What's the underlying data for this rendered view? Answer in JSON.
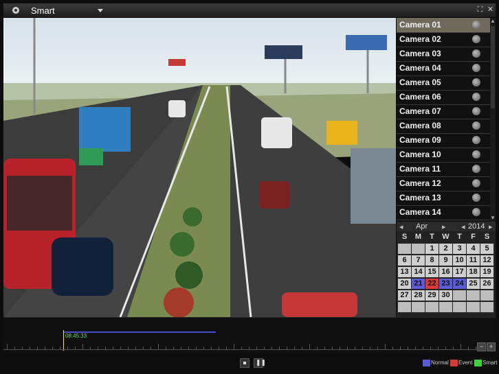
{
  "titlebar": {
    "title": "Smart"
  },
  "cameras": [
    "Camera 01",
    "Camera 02",
    "Camera 03",
    "Camera 04",
    "Camera 05",
    "Camera 06",
    "Camera 07",
    "Camera 08",
    "Camera 09",
    "Camera 10",
    "Camera 11",
    "Camera 12",
    "Camera 13",
    "Camera 14"
  ],
  "selected_camera_index": 0,
  "calendar": {
    "month": "Apr",
    "year": "2014",
    "weekdays": [
      "S",
      "M",
      "T",
      "W",
      "T",
      "F",
      "S"
    ],
    "weeks": [
      [
        "",
        "",
        "1",
        "2",
        "3",
        "4",
        "5"
      ],
      [
        "6",
        "7",
        "8",
        "9",
        "10",
        "11",
        "12"
      ],
      [
        "13",
        "14",
        "15",
        "16",
        "17",
        "18",
        "19"
      ],
      [
        "20",
        "21",
        "22",
        "23",
        "24",
        "25",
        "26"
      ],
      [
        "27",
        "28",
        "29",
        "30",
        "",
        "",
        ""
      ],
      [
        "",
        "",
        "",
        "",
        "",
        "",
        ""
      ]
    ],
    "normal_days": [
      "21",
      "23",
      "24"
    ],
    "event_days": [
      "22"
    ]
  },
  "timeline": {
    "current_time": "08:45:33"
  },
  "legend": [
    {
      "label": "Normal",
      "color": "#5b5bd8"
    },
    {
      "label": "Event",
      "color": "#d83a3a"
    },
    {
      "label": "Smart",
      "color": "#3fd23f"
    }
  ]
}
